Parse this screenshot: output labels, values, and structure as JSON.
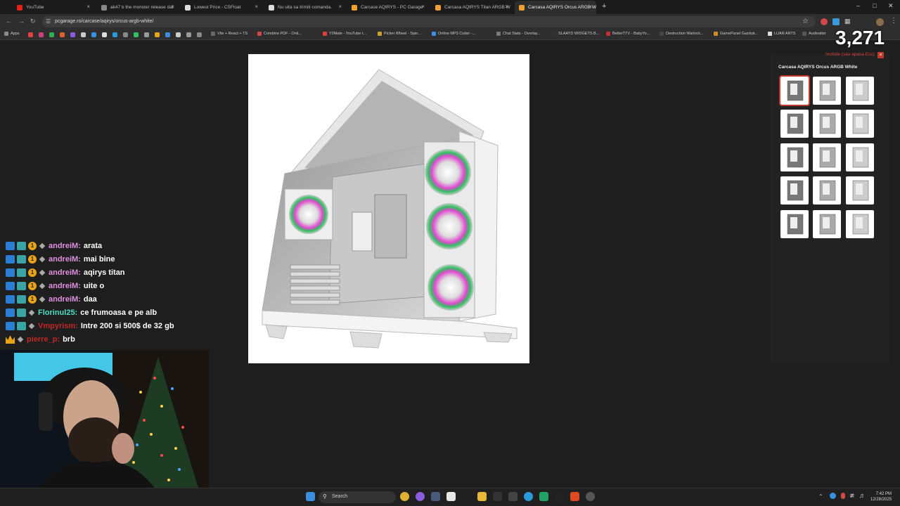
{
  "browser": {
    "tabs": [
      {
        "title": "YouTube",
        "color": "#e62117"
      },
      {
        "title": "ak47 b the monster release dat",
        "color": "#888888"
      },
      {
        "title": "Lowest Price - CSFloat",
        "color": "#dddddd"
      },
      {
        "title": "Nu uita sa trimiti comanda.",
        "color": "#dddddd"
      },
      {
        "title": "Carcase AQIRYS - PC Garage",
        "color": "#f0a030"
      },
      {
        "title": "Carcasa AQIRYS Titan ARGB W",
        "color": "#f0a030"
      },
      {
        "title": "Carcasa AQIRYS Orcus ARGB W",
        "color": "#f0a030"
      }
    ],
    "new_tab_label": "+",
    "url": "pcgarage.ro/carcase/aqirys/orcus-argb-white/",
    "bookmarks": [
      "Apps",
      "Vite + React + TS",
      "Combine PDF - Onli...",
      "Y2Mate - YouTube t...",
      "Picker Wheel - Spin...",
      "Online MP3 Cutter -...",
      "Chat Stats - Overlay...",
      "SLAAYD WIDGETS B...",
      "BetterTTV - BabyYo...",
      "Destruction Warlock...",
      "GamePanel Gazduir...",
      "LUAR ARTS",
      "Audioalter"
    ]
  },
  "overlay": {
    "viewer_count": "3,271"
  },
  "gallery": {
    "close_hint": "Inchide (sau apasa Esc)",
    "close_label": "×",
    "title": "Carcasa AQIRYS Orcus ARGB White",
    "thumb_count": 15
  },
  "chat": [
    {
      "user": "andreiM:",
      "message": "arata",
      "color": "#e090e0",
      "badges": "full"
    },
    {
      "user": "andreiM:",
      "message": "mai bine",
      "color": "#e090e0",
      "badges": "full"
    },
    {
      "user": "andreiM:",
      "message": "aqirys titan",
      "color": "#e090e0",
      "badges": "full"
    },
    {
      "user": "andreiM:",
      "message": "uite o",
      "color": "#e090e0",
      "badges": "full"
    },
    {
      "user": "andreiM:",
      "message": "daa",
      "color": "#e090e0",
      "badges": "full"
    },
    {
      "user": "Florinul25:",
      "message": "ce frumoasa e pe alb",
      "color": "#50e0c0",
      "badges": "two"
    },
    {
      "user": "Vmpyrism:",
      "message": "Intre 200 si 500$ de 32 gb",
      "color": "#c02828",
      "badges": "two"
    },
    {
      "user": "pierre_p:",
      "message": "brb",
      "color": "#c02828",
      "badges": "crown"
    }
  ],
  "taskbar": {
    "search_label": "Search",
    "time": "7:42 PM",
    "date": "12/28/2025"
  }
}
